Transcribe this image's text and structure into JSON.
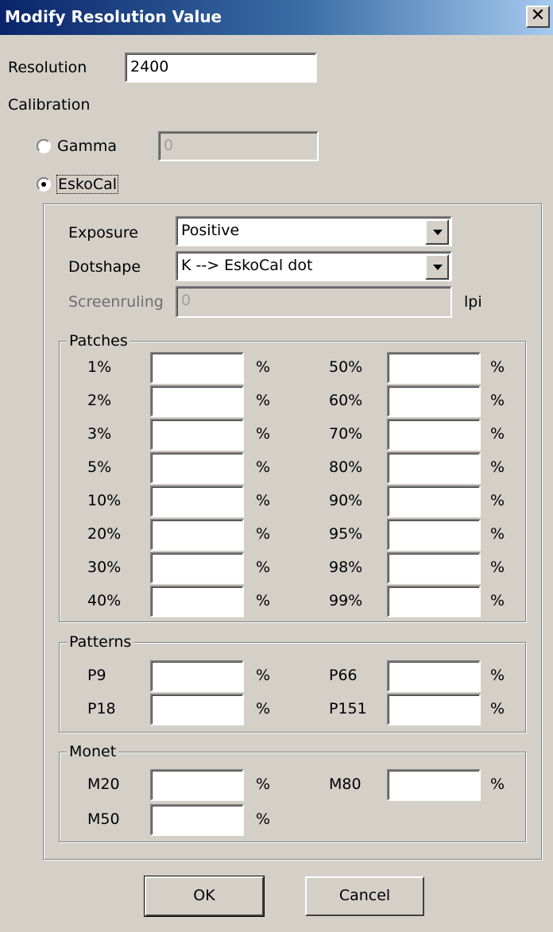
{
  "dialog": {
    "title": "Modify Resolution Value",
    "close_symbol": "✕"
  },
  "resolution": {
    "label": "Resolution",
    "value": "2400"
  },
  "calibration": {
    "label": "Calibration",
    "gamma": {
      "label": "Gamma",
      "value": "0",
      "selected": false
    },
    "eskocal": {
      "label": "EskoCal",
      "selected": true
    }
  },
  "eskocal_panel": {
    "exposure": {
      "label": "Exposure",
      "value": "Positive"
    },
    "dotshape": {
      "label": "Dotshape",
      "value": "K --> EskoCal dot"
    },
    "screenruling": {
      "label": "Screenruling",
      "value": "0",
      "unit": "lpi"
    }
  },
  "patches": {
    "title": "Patches",
    "left": [
      {
        "label": "1%",
        "value": "",
        "unit": "%"
      },
      {
        "label": "2%",
        "value": "",
        "unit": "%"
      },
      {
        "label": "3%",
        "value": "",
        "unit": "%"
      },
      {
        "label": "5%",
        "value": "",
        "unit": "%"
      },
      {
        "label": "10%",
        "value": "",
        "unit": "%"
      },
      {
        "label": "20%",
        "value": "",
        "unit": "%"
      },
      {
        "label": "30%",
        "value": "",
        "unit": "%"
      },
      {
        "label": "40%",
        "value": "",
        "unit": "%"
      }
    ],
    "right": [
      {
        "label": "50%",
        "value": "",
        "unit": "%"
      },
      {
        "label": "60%",
        "value": "",
        "unit": "%"
      },
      {
        "label": "70%",
        "value": "",
        "unit": "%"
      },
      {
        "label": "80%",
        "value": "",
        "unit": "%"
      },
      {
        "label": "90%",
        "value": "",
        "unit": "%"
      },
      {
        "label": "95%",
        "value": "",
        "unit": "%"
      },
      {
        "label": "98%",
        "value": "",
        "unit": "%"
      },
      {
        "label": "99%",
        "value": "",
        "unit": "%"
      }
    ]
  },
  "patterns": {
    "title": "Patterns",
    "left": [
      {
        "label": "P9",
        "value": "",
        "unit": "%"
      },
      {
        "label": "P18",
        "value": "",
        "unit": "%"
      }
    ],
    "right": [
      {
        "label": "P66",
        "value": "",
        "unit": "%"
      },
      {
        "label": "P151",
        "value": "",
        "unit": "%"
      }
    ]
  },
  "monet": {
    "title": "Monet",
    "left": [
      {
        "label": "M20",
        "value": "",
        "unit": "%"
      },
      {
        "label": "M50",
        "value": "",
        "unit": "%"
      }
    ],
    "right": [
      {
        "label": "M80",
        "value": "",
        "unit": "%"
      }
    ]
  },
  "buttons": {
    "ok": "OK",
    "cancel": "Cancel"
  },
  "colors": {
    "titlebar_start": "#0a246a",
    "titlebar_end": "#a6caf0",
    "face": "#d4d0c8"
  }
}
